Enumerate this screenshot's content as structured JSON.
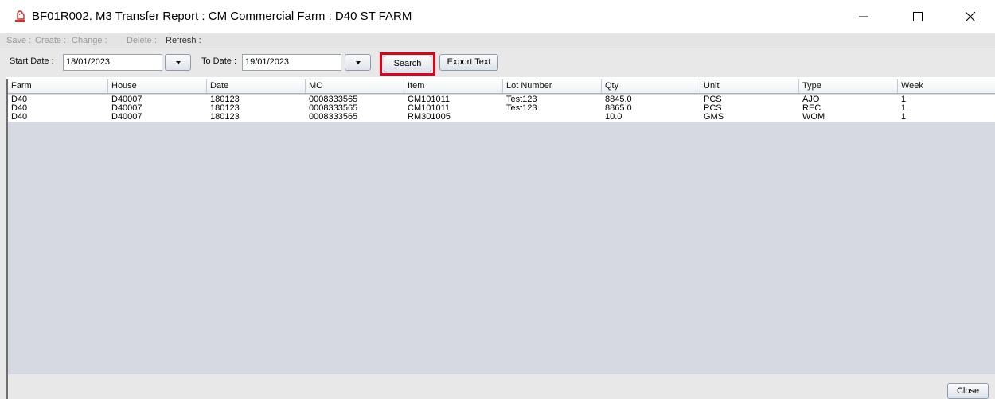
{
  "window": {
    "title": "BF01R002. M3 Transfer Report : CM Commercial Farm : D40 ST FARM",
    "minimize_label": "minimize",
    "maximize_label": "maximize",
    "close_label": "close"
  },
  "menu": {
    "items": [
      {
        "label": "Save :",
        "enabled": false
      },
      {
        "label": "Create :",
        "enabled": false
      },
      {
        "label": "Change :",
        "enabled": false
      },
      {
        "label": "Delete :",
        "enabled": false
      },
      {
        "label": "Refresh :",
        "enabled": true
      }
    ]
  },
  "toolbar": {
    "start_date_label": "Start Date :",
    "start_date_value": "18/01/2023",
    "to_date_label": "To Date :",
    "to_date_value": "19/01/2023",
    "search_label": "Search",
    "export_label": "Export Text"
  },
  "table": {
    "columns": [
      "Farm",
      "House",
      "Date",
      "MO",
      "Item",
      "Lot Number",
      "Qty",
      "Unit",
      "Type",
      "Week"
    ],
    "rows": [
      [
        "D40",
        "D40007",
        "180123",
        "0008333565",
        "CM101011",
        "Test123",
        "8845.0",
        "PCS",
        "AJO",
        "1"
      ],
      [
        "D40",
        "D40007",
        "180123",
        "0008333565",
        "CM101011",
        "Test123",
        "8865.0",
        "PCS",
        "REC",
        "1"
      ],
      [
        "D40",
        "D40007",
        "180123",
        "0008333565",
        "RM301005",
        "",
        "10.0",
        "GMS",
        "WOM",
        "1"
      ]
    ]
  },
  "footer": {
    "close_label": "Close"
  },
  "colors": {
    "highlight": "#e00018",
    "table_background": "#d6d9e0"
  }
}
